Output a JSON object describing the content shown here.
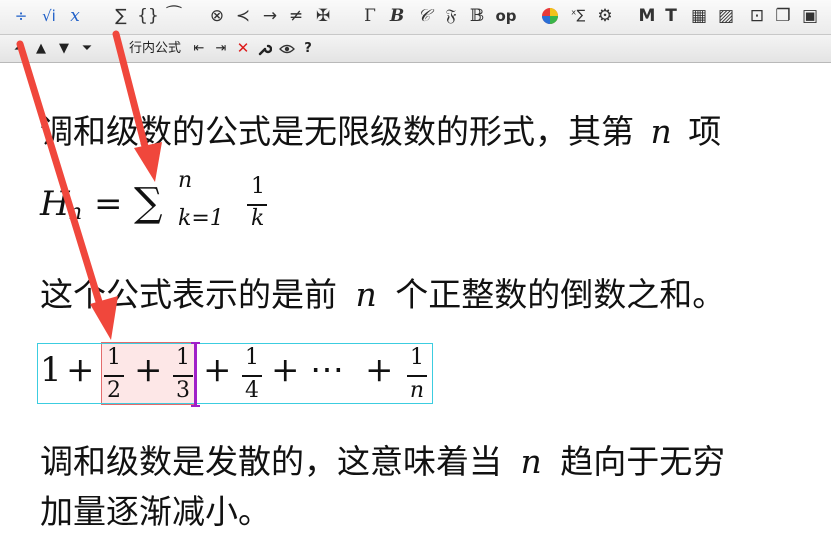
{
  "toolbar_row1": {
    "tools": [
      {
        "name": "fraction-tool-icon",
        "glyph": "÷"
      },
      {
        "name": "radical-tool-icon",
        "glyph": "√i"
      },
      {
        "name": "superscript-tool-icon",
        "glyph": "x"
      },
      {
        "name": "sum-tool-icon",
        "glyph": "∑"
      },
      {
        "name": "braces-tool-icon",
        "glyph": "{}"
      },
      {
        "name": "accent-tool-icon",
        "glyph": "⁀"
      },
      {
        "name": "otimes-tool-icon",
        "glyph": "⊗"
      },
      {
        "name": "prec-tool-icon",
        "glyph": "≺"
      },
      {
        "name": "rightarrow-tool-icon",
        "glyph": "→"
      },
      {
        "name": "neq-tool-icon",
        "glyph": "≠"
      },
      {
        "name": "misc-symbol-tool-icon",
        "glyph": "✠"
      },
      {
        "name": "greek-tool-icon",
        "glyph": "Γ"
      },
      {
        "name": "bold-tool-icon",
        "glyph": "B"
      },
      {
        "name": "script-tool-icon",
        "glyph": "𝒞"
      },
      {
        "name": "fraktur-tool-icon",
        "glyph": "𝔉"
      },
      {
        "name": "blackboard-tool-icon",
        "glyph": "𝔹"
      },
      {
        "name": "operator-tool-icon",
        "glyph": "op"
      },
      {
        "name": "color-tool-icon",
        "glyph": "●"
      },
      {
        "name": "sum-limits-tool-icon",
        "glyph": "ˣ∑"
      },
      {
        "name": "settings-tool-icon",
        "glyph": "⚙"
      },
      {
        "name": "mathml-tool-icon",
        "glyph": "M"
      },
      {
        "name": "text-tool-icon",
        "glyph": "T"
      },
      {
        "name": "matrix-tool-icon",
        "glyph": "▦"
      },
      {
        "name": "image-tool-icon",
        "glyph": "▨"
      },
      {
        "name": "link-tool-icon",
        "glyph": "⊡"
      },
      {
        "name": "copy-tool-icon",
        "glyph": "❐"
      },
      {
        "name": "save-tool-icon",
        "glyph": "▣"
      }
    ]
  },
  "toolbar_row2": {
    "inline_formula_label": "行内公式",
    "tools": [
      {
        "name": "move-top-icon",
        "glyph": "⏶"
      },
      {
        "name": "move-up-icon",
        "glyph": "▲"
      },
      {
        "name": "move-down-icon",
        "glyph": "▼"
      },
      {
        "name": "move-bottom-icon",
        "glyph": "⏷"
      },
      {
        "name": "insert-before-icon",
        "glyph": "⇤"
      },
      {
        "name": "insert-after-icon",
        "glyph": "⇥"
      },
      {
        "name": "delete-icon",
        "glyph": "✕"
      },
      {
        "name": "wrench-icon",
        "glyph": "🔧"
      },
      {
        "name": "preview-eye-icon",
        "glyph": "👁"
      },
      {
        "name": "help-icon",
        "glyph": "?"
      }
    ]
  },
  "document": {
    "line1_text": "调和级数的公式是无限级数的形式，其第",
    "line1_var": "n",
    "line1_tail": "项",
    "hn_H": "H",
    "hn_sub": "n",
    "hn_eq": "=",
    "hn_sum": "∑",
    "hn_upper": "n",
    "hn_lower": "k=1",
    "hn_num": "1",
    "hn_den": "k",
    "line3_a": "这个公式表示的是前",
    "line3_var": "n",
    "line3_b": "个正整数的倒数之和。",
    "expr_one": "1",
    "expr_plus": "+",
    "expr_dots": "⋯",
    "fractions": [
      {
        "num": "1",
        "den": "2"
      },
      {
        "num": "1",
        "den": "3"
      },
      {
        "num": "1",
        "den": "4"
      },
      {
        "num": "1",
        "den": "n"
      }
    ],
    "line5_a": "调和级数是发散的，这意味着当",
    "line5_var": "n",
    "line5_b": "趋向于无穷",
    "line6": "加量逐渐减小。"
  },
  "colors": {
    "arrow": "#f0473c",
    "selection_border": "#e36b6b",
    "selection_fill": "#fde7e7",
    "expression_border": "#3ccde0",
    "caret": "#a020c8"
  }
}
